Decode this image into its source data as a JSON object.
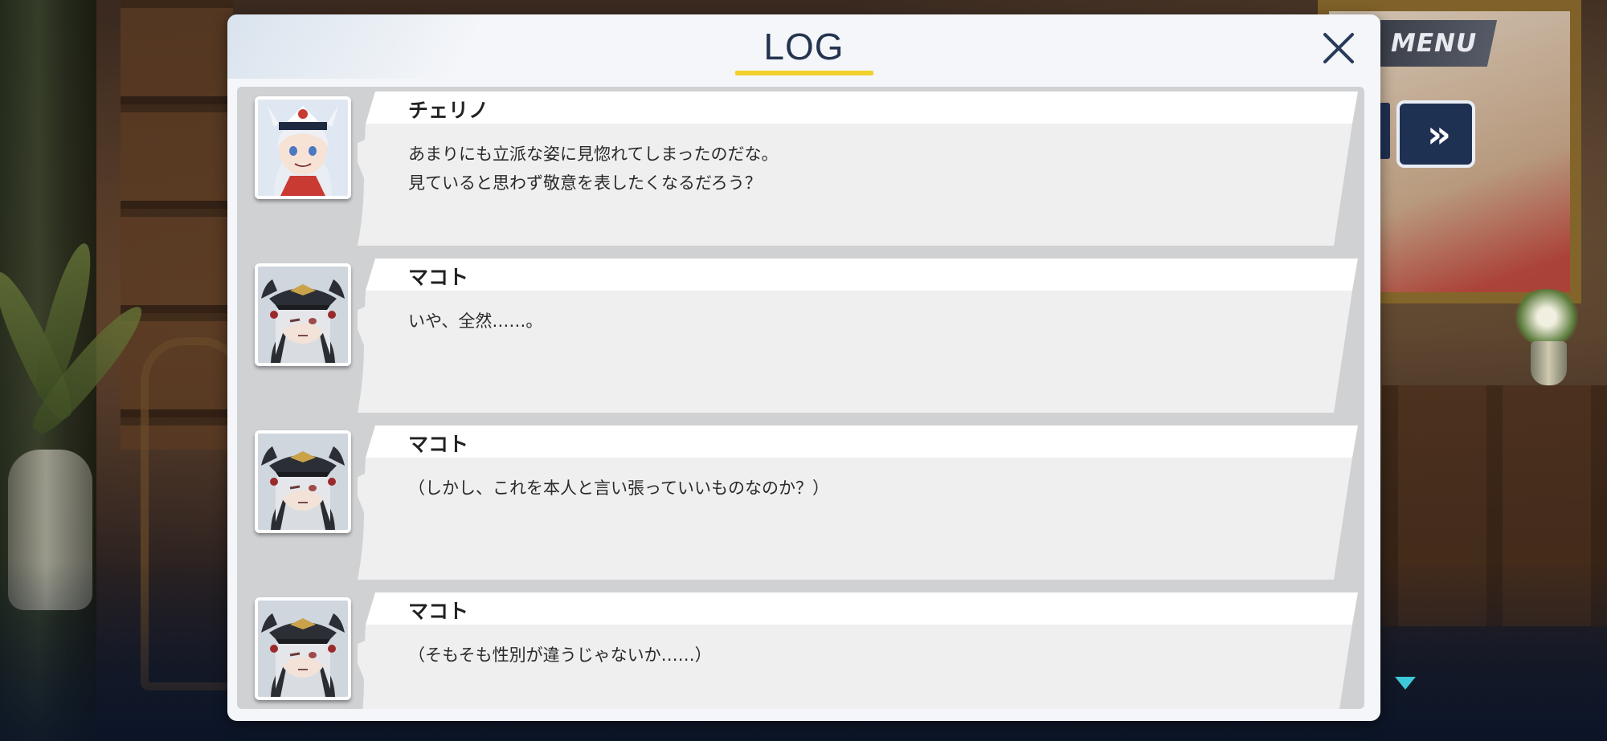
{
  "hud": {
    "menu_label": "MENU",
    "fast_forward_label": "»"
  },
  "log": {
    "title": "LOG",
    "entries": [
      {
        "speaker": "チェリノ",
        "portrait": "cherino-portrait",
        "lines": [
          "あまりにも立派な姿に見惚れてしまったのだな。",
          "見ていると思わず敬意を表したくなるだろう？"
        ]
      },
      {
        "speaker": "マコト",
        "portrait": "makoto-portrait",
        "lines": [
          "いや、全然……。"
        ]
      },
      {
        "speaker": "マコト",
        "portrait": "makoto-portrait",
        "lines": [
          "（しかし、これを本人と言い張っていいものなのか？）"
        ]
      },
      {
        "speaker": "マコト",
        "portrait": "makoto-portrait",
        "lines": [
          "（そもそも性別が違うじゃないか……）"
        ]
      }
    ]
  },
  "colors": {
    "title": "#243450",
    "underline": "#f2d02a",
    "fast_forward_bg": "#1f3152",
    "scroll_arrow": "#3ec8d8"
  }
}
